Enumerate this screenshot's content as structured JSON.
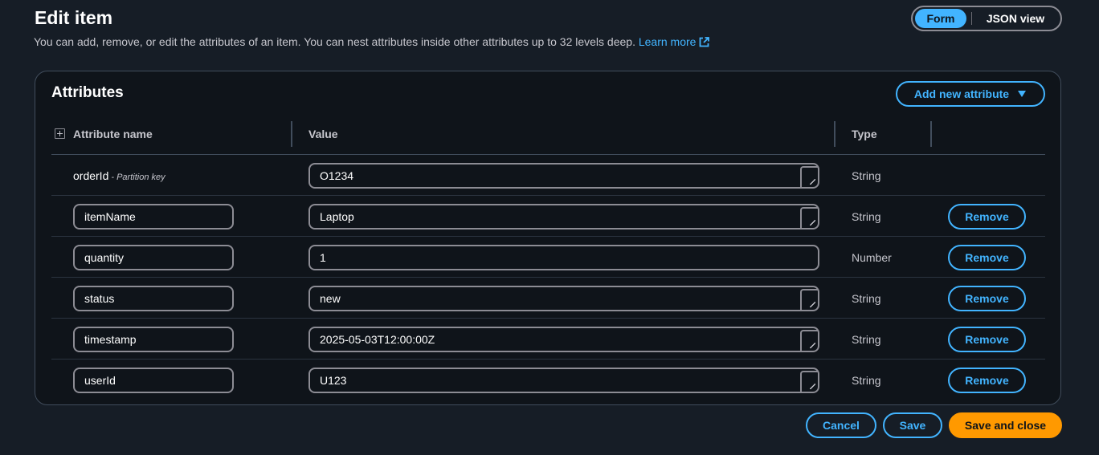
{
  "header": {
    "title": "Edit item",
    "description": "You can add, remove, or edit the attributes of an item. You can nest attributes inside other attributes up to 32 levels deep.",
    "learn_more": "Learn more"
  },
  "view_toggle": {
    "options": [
      "Form",
      "JSON view"
    ],
    "selected": "Form"
  },
  "attributes": {
    "title": "Attributes",
    "add_button": "Add new attribute",
    "columns": {
      "name": "Attribute name",
      "value": "Value",
      "type": "Type"
    },
    "partition_key": {
      "name": "orderId",
      "note": "- Partition key",
      "value": "O1234",
      "type": "String"
    },
    "rows": [
      {
        "name": "itemName",
        "value": "Laptop",
        "type": "String",
        "remove": "Remove"
      },
      {
        "name": "quantity",
        "value": "1",
        "type": "Number",
        "remove": "Remove"
      },
      {
        "name": "status",
        "value": "new",
        "type": "String",
        "remove": "Remove"
      },
      {
        "name": "timestamp",
        "value": "2025-05-03T12:00:00Z",
        "type": "String",
        "remove": "Remove"
      },
      {
        "name": "userId",
        "value": "U123",
        "type": "String",
        "remove": "Remove"
      }
    ]
  },
  "footer": {
    "cancel": "Cancel",
    "save": "Save",
    "save_close": "Save and close"
  },
  "colors": {
    "background": "#161d26",
    "panel": "#0f141a",
    "accent": "#42b4ff",
    "primary": "#ff9900"
  }
}
